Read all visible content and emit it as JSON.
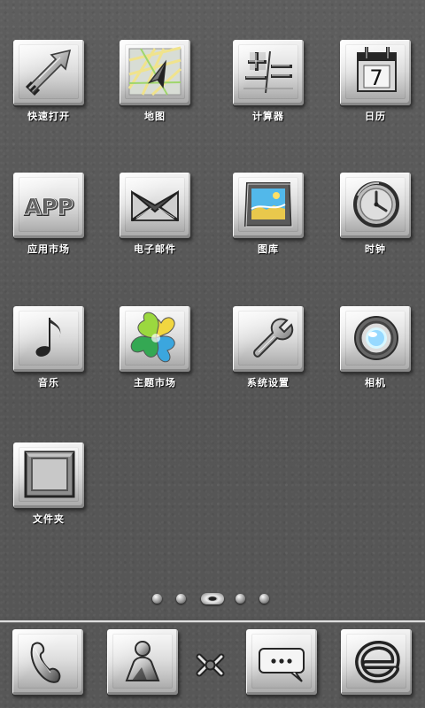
{
  "apps": [
    {
      "label": "快速打开",
      "icon": "arrow-icon"
    },
    {
      "label": "地图",
      "icon": "map-icon"
    },
    {
      "label": "计算器",
      "icon": "calculator-icon"
    },
    {
      "label": "日历",
      "icon": "calendar-icon",
      "number": "7"
    },
    {
      "label": "应用市场",
      "icon": "app-store-icon",
      "text": "APP"
    },
    {
      "label": "电子邮件",
      "icon": "mail-icon"
    },
    {
      "label": "图库",
      "icon": "gallery-icon"
    },
    {
      "label": "时钟",
      "icon": "clock-icon"
    },
    {
      "label": "音乐",
      "icon": "music-icon"
    },
    {
      "label": "主题市场",
      "icon": "theme-market-icon"
    },
    {
      "label": "系统设置",
      "icon": "settings-icon"
    },
    {
      "label": "相机",
      "icon": "camera-icon"
    },
    {
      "label": "文件夹",
      "icon": "folder-icon"
    }
  ],
  "pager": {
    "count": 5,
    "active": 2
  },
  "dock": [
    {
      "icon": "phone-icon"
    },
    {
      "icon": "contacts-icon"
    },
    {
      "icon": "app-drawer-icon"
    },
    {
      "icon": "messages-icon"
    },
    {
      "icon": "browser-icon"
    }
  ]
}
